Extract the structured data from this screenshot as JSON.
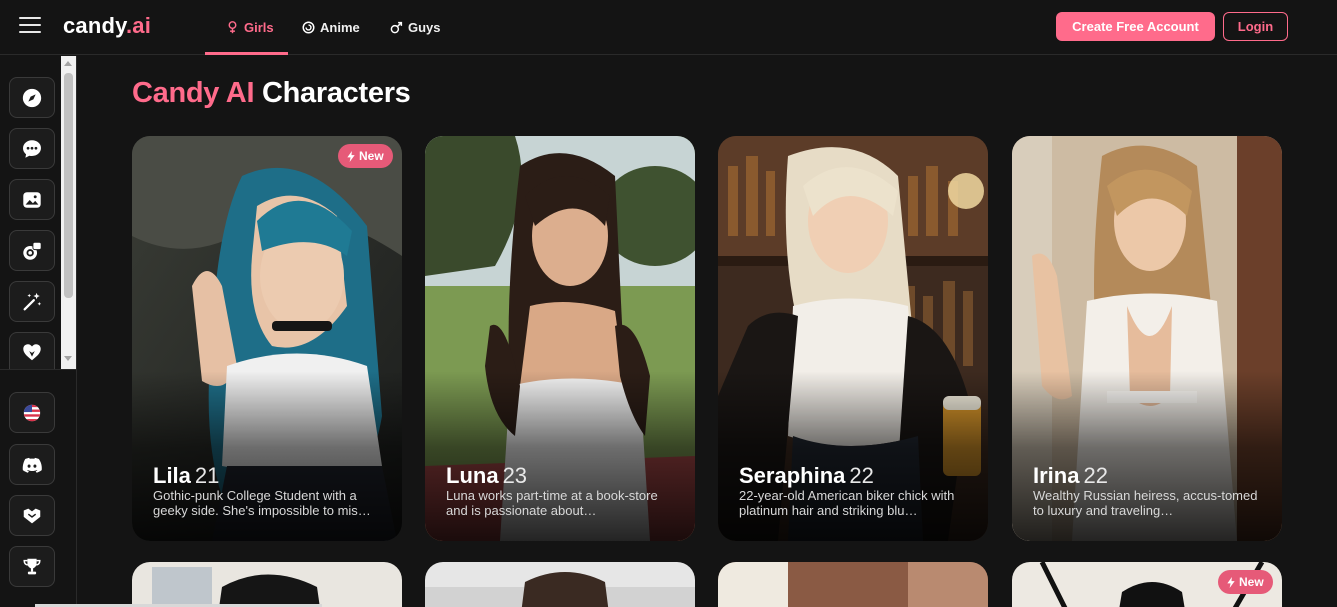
{
  "app": {
    "logo_main": "candy",
    "logo_dot": ".",
    "logo_ai": "ai"
  },
  "nav": {
    "tabs": [
      {
        "label": "Girls",
        "icon": "female-icon",
        "active": true
      },
      {
        "label": "Anime",
        "icon": "anime-swirl-icon",
        "active": false
      },
      {
        "label": "Guys",
        "icon": "male-icon",
        "active": false
      }
    ],
    "create_account": "Create Free Account",
    "login": "Login"
  },
  "sidebar": {
    "items": [
      {
        "icon": "compass-icon",
        "label": "Explore"
      },
      {
        "icon": "chat-icon",
        "label": "Chat"
      },
      {
        "icon": "gallery-icon",
        "label": "Gallery"
      },
      {
        "icon": "generate-image-icon",
        "label": "Generate Image"
      },
      {
        "icon": "magic-wand-icon",
        "label": "Create Character"
      },
      {
        "icon": "heart-icon",
        "label": "My AI"
      },
      {
        "icon": "us-flag-icon",
        "label": "Language"
      },
      {
        "icon": "discord-icon",
        "label": "Discord"
      },
      {
        "icon": "affiliate-icon",
        "label": "Affiliate"
      },
      {
        "icon": "trophy-icon",
        "label": "Leaderboard"
      }
    ]
  },
  "main": {
    "title_pink": "Candy AI",
    "title_white": "Characters"
  },
  "cards": [
    {
      "name": "Lila",
      "age": "21",
      "desc": "Gothic-punk College Student with a geeky side. She's impossible to mis…",
      "badge": "New"
    },
    {
      "name": "Luna",
      "age": "23",
      "desc": "Luna works part-time at a book-store and is passionate about…",
      "badge": ""
    },
    {
      "name": "Seraphina",
      "age": "22",
      "desc": "22-year-old American biker chick with platinum hair and striking blu…",
      "badge": ""
    },
    {
      "name": "Irina",
      "age": "22",
      "desc": "Wealthy Russian heiress, accus-tomed to luxury and traveling…",
      "badge": ""
    }
  ],
  "row2": {
    "badge": "New"
  },
  "colors": {
    "accent": "#ff6b8b",
    "background": "#141414"
  }
}
